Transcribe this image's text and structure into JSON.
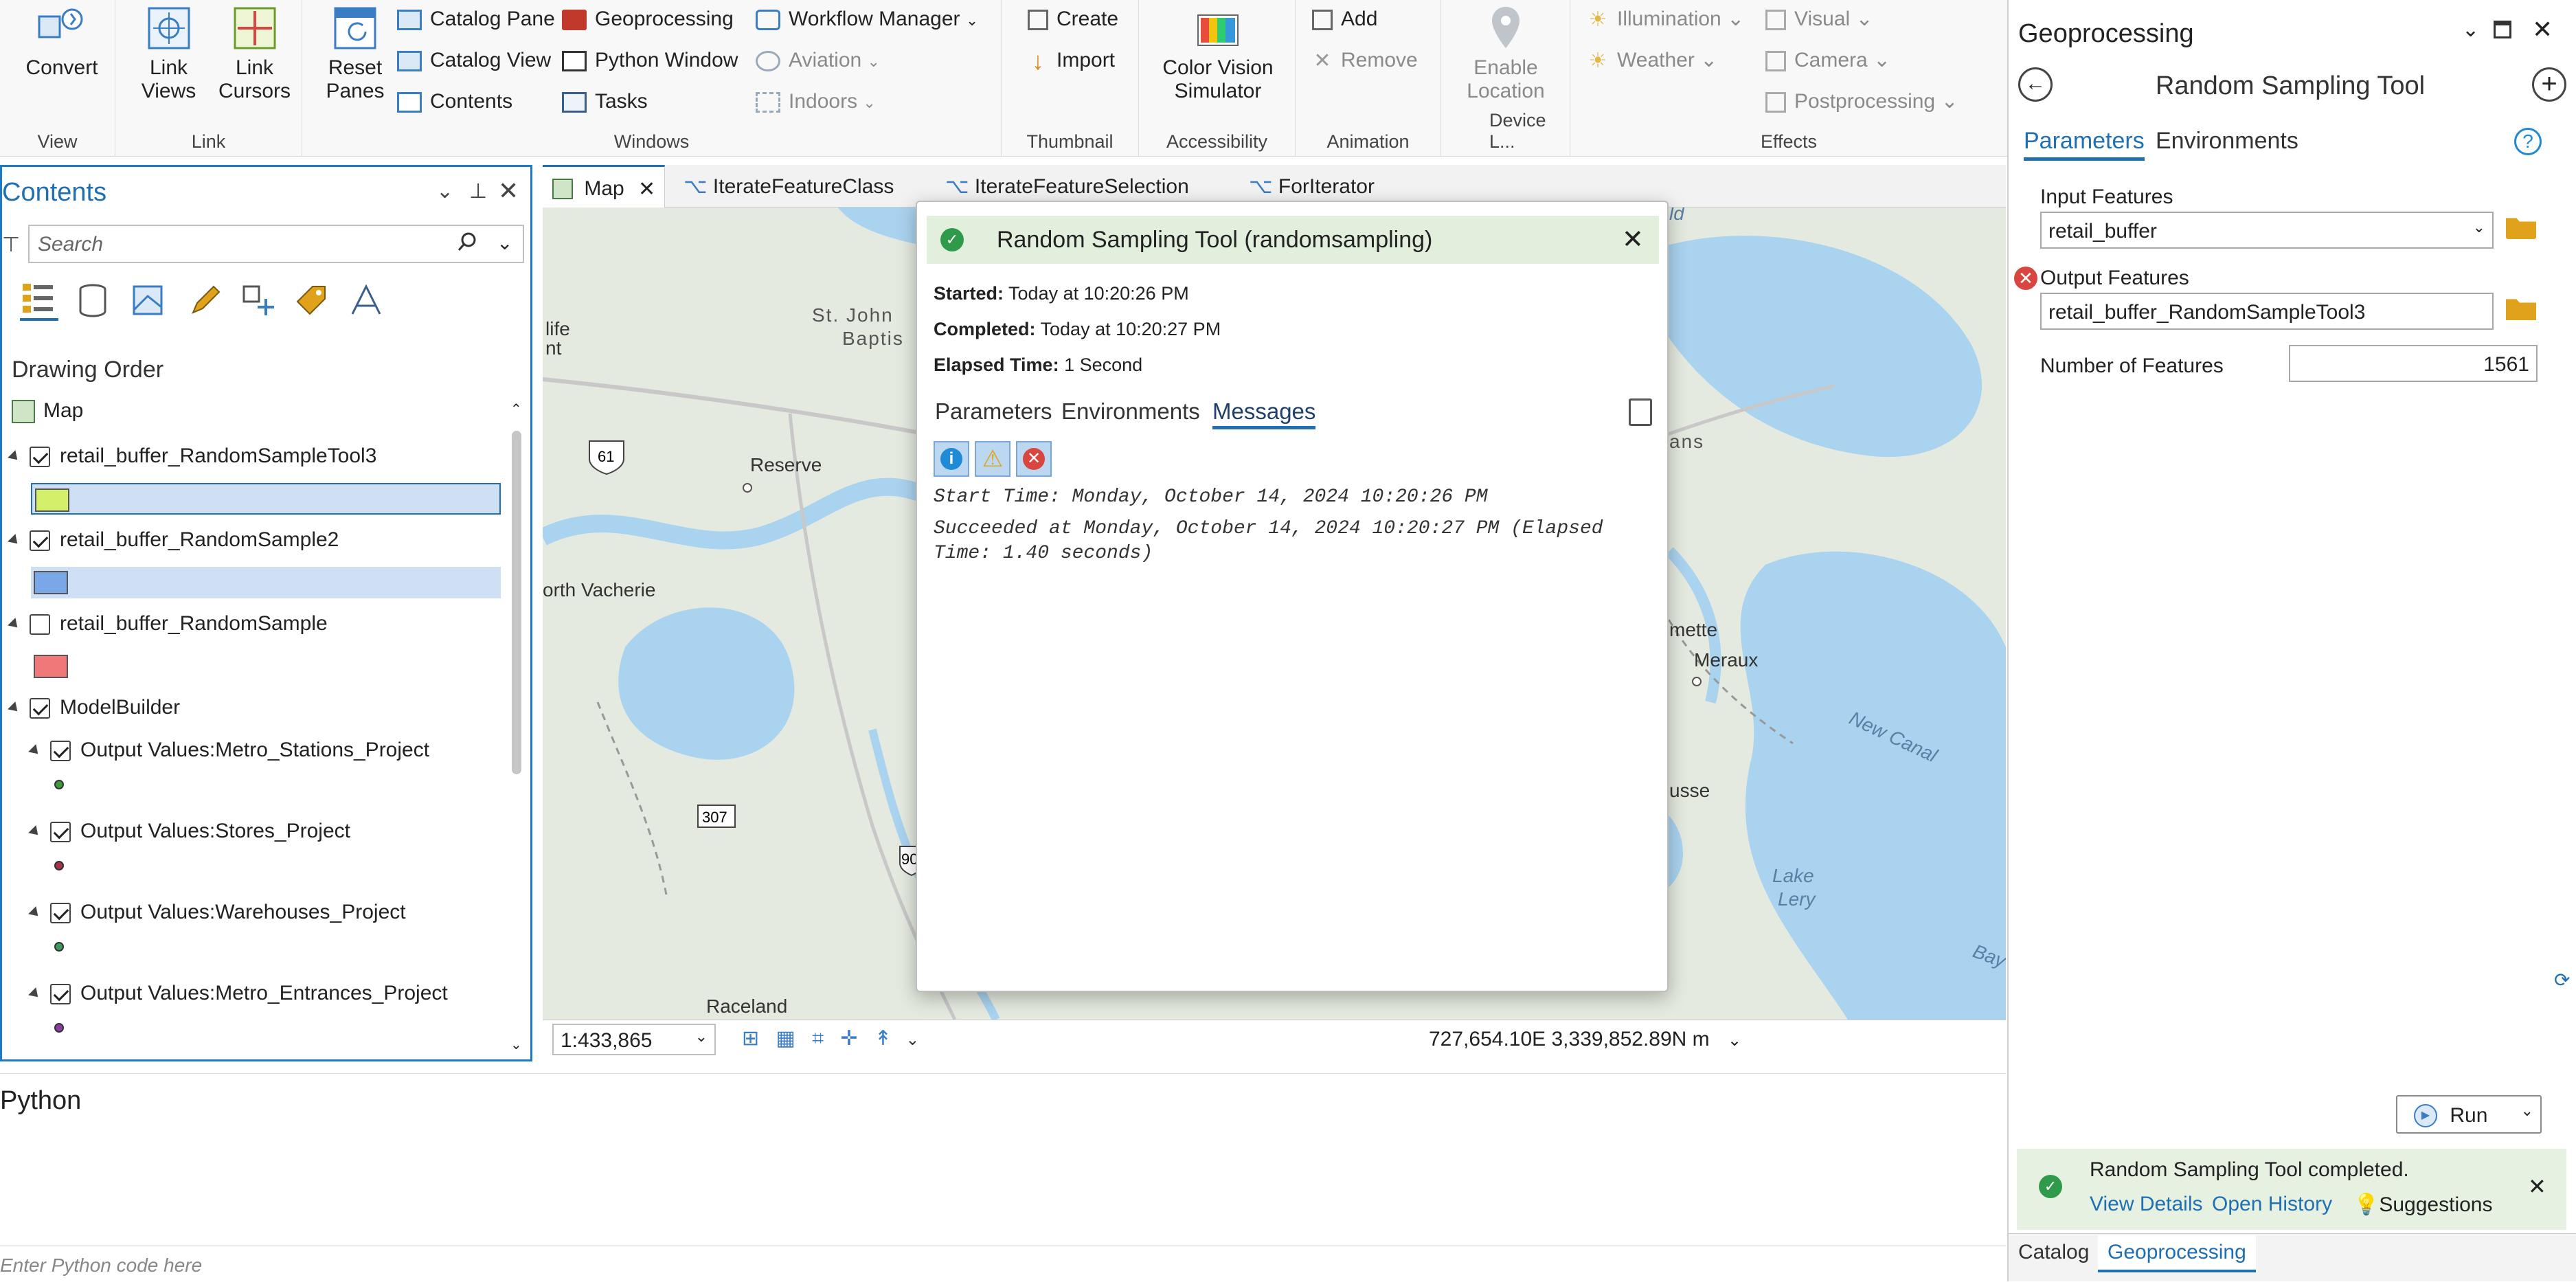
{
  "ribbon": {
    "view_group": {
      "label": "View",
      "convert": "Convert"
    },
    "link_group": {
      "label": "Link",
      "link_views": "Link\nViews",
      "link_cursors": "Link\nCursors"
    },
    "windows_group": {
      "label": "Windows",
      "reset_panes": "Reset\nPanes",
      "catalog_pane": "Catalog Pane",
      "catalog_view": "Catalog View",
      "contents": "Contents",
      "geoprocessing": "Geoprocessing",
      "python_window": "Python Window",
      "tasks": "Tasks",
      "workflow_manager": "Workflow Manager",
      "aviation": "Aviation",
      "indoors": "Indoors"
    },
    "thumbnail_group": {
      "label": "Thumbnail",
      "create": "Create",
      "import": "Import"
    },
    "accessibility_group": {
      "label": "Accessibility",
      "color_vision": "Color Vision\nSimulator"
    },
    "animation_group": {
      "label": "Animation",
      "add": "Add",
      "remove": "Remove"
    },
    "device_group": {
      "label": "Device L...",
      "enable_location": "Enable\nLocation"
    },
    "effects_group": {
      "label": "Effects",
      "illumination": "Illumination",
      "weather": "Weather",
      "visual": "Visual",
      "camera": "Camera",
      "postprocessing": "Postprocessing"
    }
  },
  "contents": {
    "title": "Contents",
    "search_placeholder": "Search",
    "drawing_order": "Drawing Order",
    "map_label": "Map",
    "layers": [
      {
        "name": "retail_buffer_RandomSampleTool3",
        "checked": true,
        "color": "#d4f06a"
      },
      {
        "name": "retail_buffer_RandomSample2",
        "checked": true,
        "color": "#7aa7e8"
      },
      {
        "name": "retail_buffer_RandomSample",
        "checked": false,
        "color": "#f07878"
      }
    ],
    "group_name": "ModelBuilder",
    "outputs": [
      {
        "name": "Output Values:Metro_Stations_Project",
        "color": "#3c9a3c"
      },
      {
        "name": "Output Values:Stores_Project",
        "color": "#a8324a"
      },
      {
        "name": "Output Values:Warehouses_Project",
        "color": "#3c9a5a"
      },
      {
        "name": "Output Values:Metro_Entrances_Project",
        "color": "#8a3fa0"
      }
    ]
  },
  "map_tabs": [
    "Map",
    "IterateFeatureClass",
    "IterateFeatureSelection",
    "ForIterator"
  ],
  "map": {
    "labels": {
      "st_john": "St. John",
      "baptis": "Baptis",
      "life": "life",
      "nt": "nt",
      "reserve": "Reserve",
      "north_vacherie": "orth Vacherie",
      "raceland": "Raceland",
      "ld": "ld",
      "ans": "ans",
      "mette": "mette",
      "meraux": "Meraux",
      "new_canal": "New Canal",
      "lake_lery": "Lake\nLery",
      "usse": "usse",
      "bay": "Bay",
      "r61": "61",
      "r307": "307",
      "r90": "90"
    },
    "scale": "1:433,865",
    "coords": "727,654.10E 3,339,852.89N m"
  },
  "dialog": {
    "title": "Random Sampling Tool (randomsampling)",
    "started_label": "Started:",
    "started_value": "Today at 10:20:26 PM",
    "completed_label": "Completed:",
    "completed_value": "Today at 10:20:27 PM",
    "elapsed_label": "Elapsed Time:",
    "elapsed_value": "1 Second",
    "tabs": [
      "Parameters",
      "Environments",
      "Messages"
    ],
    "message1": "Start Time: Monday, October 14, 2024 10:20:26 PM",
    "message2": "Succeeded at Monday, October 14, 2024 10:20:27 PM (Elapsed\nTime: 1.40 seconds)"
  },
  "geoprocessing": {
    "pane_title": "Geoprocessing",
    "tool_title": "Random Sampling Tool",
    "tabs": [
      "Parameters",
      "Environments"
    ],
    "input_label": "Input Features",
    "input_value": "retail_buffer",
    "output_label": "Output Features",
    "output_value": "retail_buffer_RandomSampleTool3",
    "count_label": "Number of Features",
    "count_value": "1561",
    "run": "Run",
    "completed_msg": "Random Sampling Tool completed.",
    "view_details": "View Details",
    "open_history": "Open History",
    "suggestions": "Suggestions",
    "bottom_tabs": [
      "Catalog",
      "Geoprocessing"
    ]
  },
  "python": {
    "title": "Python",
    "placeholder": "Enter Python code here"
  },
  "colors": {
    "accent": "#1f6fb2",
    "success": "#2e9a4a",
    "error": "#d9463f",
    "water": "#aad3f0"
  }
}
